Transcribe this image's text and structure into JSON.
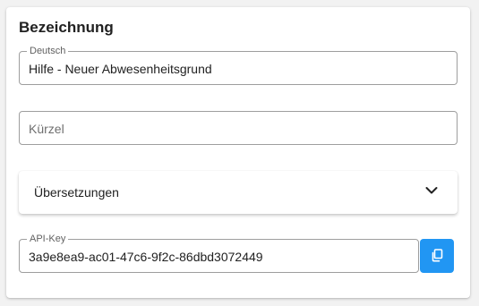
{
  "section": {
    "title": "Bezeichnung"
  },
  "fields": {
    "name": {
      "legend": "Deutsch",
      "value": "Hilfe - Neuer Abwesenheitsgrund"
    },
    "short": {
      "placeholder": "Kürzel"
    },
    "translations": {
      "label": "Übersetzungen",
      "icon": "chevron-down-icon"
    },
    "api_key": {
      "legend": "API-Key",
      "value": "3a9e8ea9-ac01-47c6-9f2c-86dbd3072449",
      "copy_icon": "copy-icon"
    }
  },
  "colors": {
    "accent": "#2196f3",
    "border": "#9e9e9e",
    "text": "#212121",
    "muted": "#616161"
  }
}
